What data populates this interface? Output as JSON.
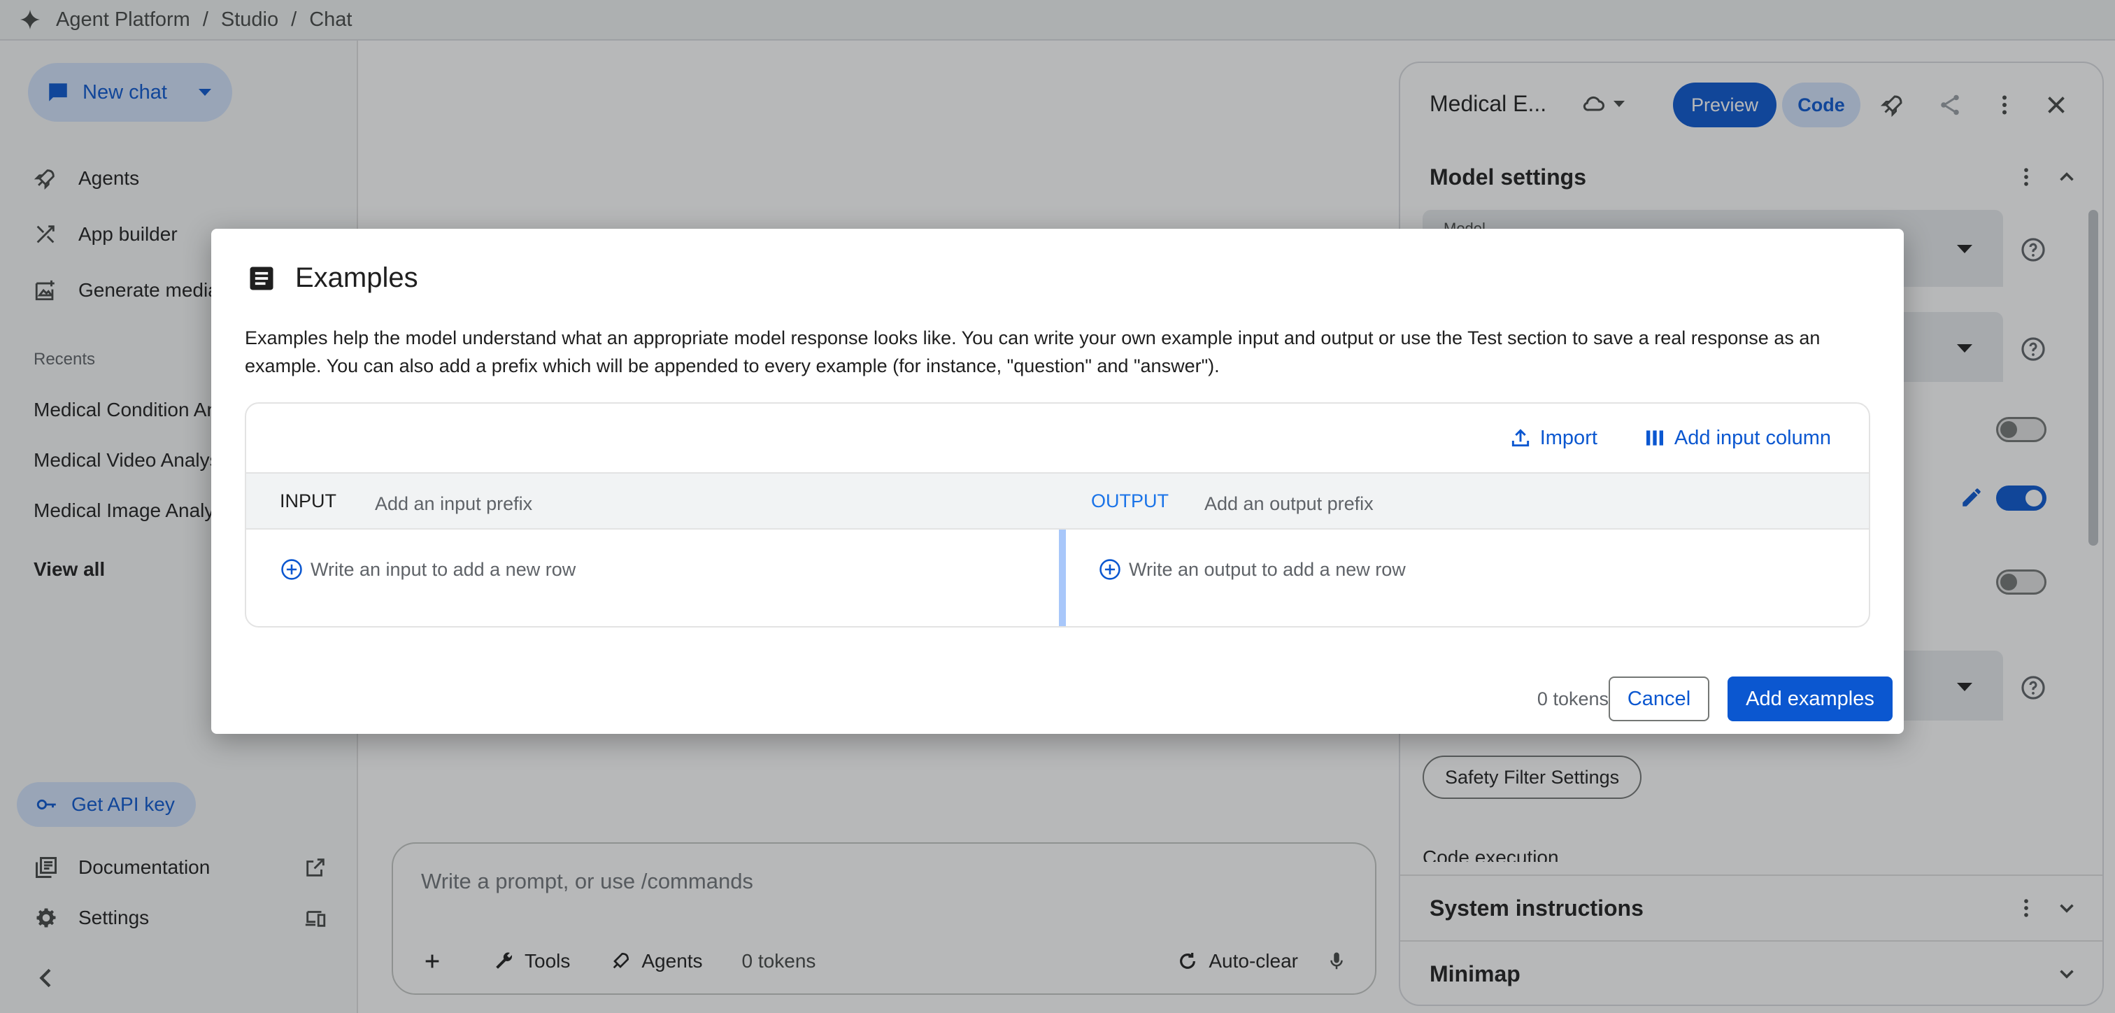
{
  "topbar": {
    "crumbs": [
      "Agent Platform",
      "Studio",
      "Chat"
    ]
  },
  "sidebar": {
    "new_chat": "New chat",
    "nav": [
      {
        "label": "Agents",
        "icon": "rocket-icon"
      },
      {
        "label": "App builder",
        "icon": "app-builder-icon"
      },
      {
        "label": "Generate media",
        "icon": "generate-media-icon"
      }
    ],
    "recents_label": "Recents",
    "recents": [
      "Medical Condition Analysis",
      "Medical Video Analysis",
      "Medical Image Analysis"
    ],
    "view_all": "View all",
    "api_key": "Get API key",
    "documentation": "Documentation",
    "settings": "Settings"
  },
  "prompt": {
    "placeholder": "Write a prompt, or use /commands",
    "tools": "Tools",
    "agents": "Agents",
    "tokens": "0 tokens",
    "auto_clear": "Auto-clear"
  },
  "right_panel": {
    "title": "Medical E...",
    "preview": "Preview",
    "code": "Code",
    "model_settings": "Model settings",
    "model_label": "Model",
    "safety_button": "Safety Filter Settings",
    "code_execution": "Code execution",
    "system_instructions": "System instructions",
    "minimap": "Minimap"
  },
  "dialog": {
    "title": "Examples",
    "description": "Examples help the model understand what an appropriate model response looks like. You can write your own example input and output or use the Test section to save a real response as an example. You can also add a prefix which will be appended to every example (for instance, \"question\" and \"answer\").",
    "import": "Import",
    "add_input_column": "Add input column",
    "input_label": "INPUT",
    "input_prefix_placeholder": "Add an input prefix",
    "output_label": "OUTPUT",
    "output_prefix_placeholder": "Add an output prefix",
    "input_row_placeholder": "Write an input to add a new row",
    "output_row_placeholder": "Write an output to add a new row",
    "tokens": "0 tokens",
    "cancel": "Cancel",
    "add_examples": "Add examples"
  },
  "colors": {
    "accent": "#0b57d0",
    "accent_light": "#d3e3fd",
    "output_label": "#1a73e8",
    "divider": "#a8c7fa"
  }
}
